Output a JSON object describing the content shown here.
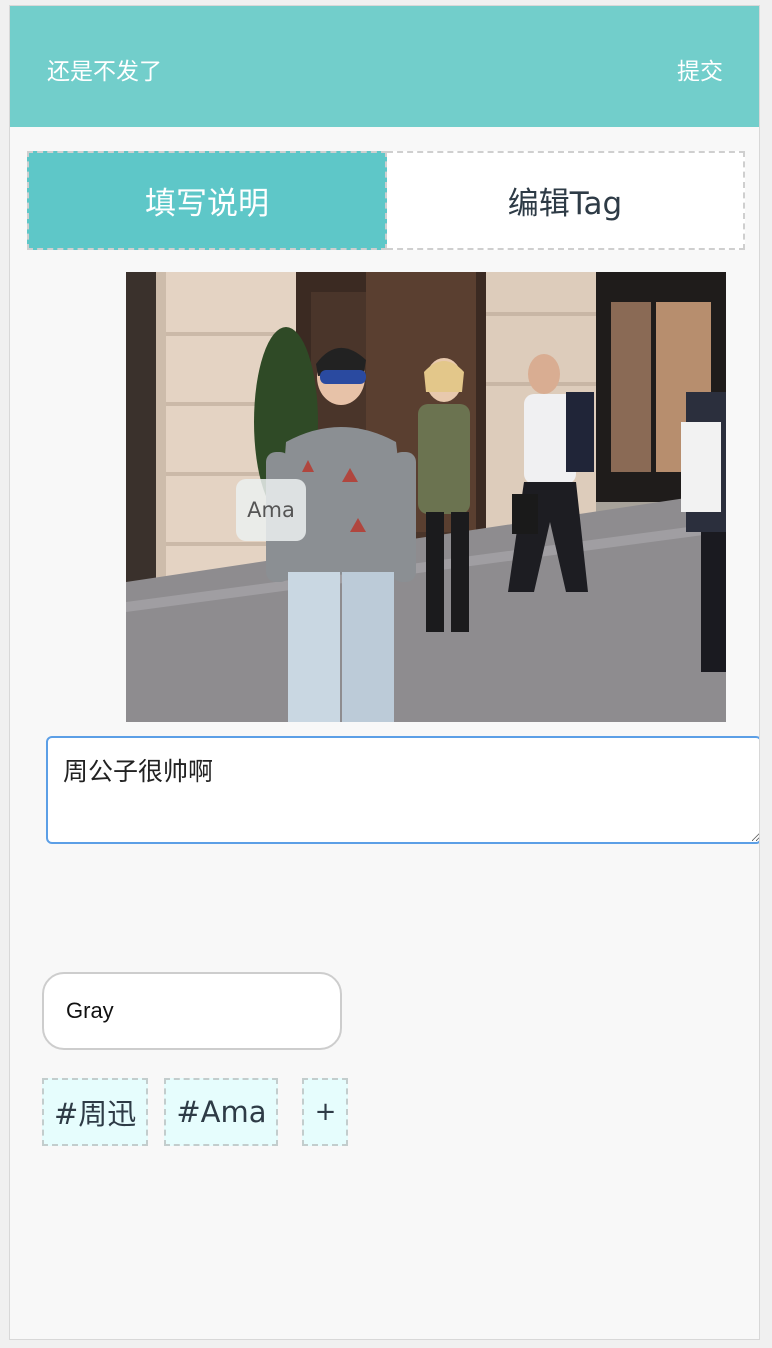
{
  "header": {
    "cancel_label": "还是不发了",
    "submit_label": "提交",
    "background": "#72cecb"
  },
  "tabs": [
    {
      "label": "填写说明",
      "active": true
    },
    {
      "label": "编辑Tag",
      "active": false
    }
  ],
  "photo": {
    "tag_label": "Ama"
  },
  "description": {
    "value": "周公子很帅啊"
  },
  "tag_input": {
    "value": "Gray"
  },
  "tag_chips": [
    {
      "label": "#周迅"
    },
    {
      "label": "#Ama"
    }
  ],
  "add_chip_label": "+",
  "colors": {
    "accent": "#5ec7c8",
    "focus_border": "#5c9fe6",
    "chip_bg": "#e6fdfd"
  }
}
